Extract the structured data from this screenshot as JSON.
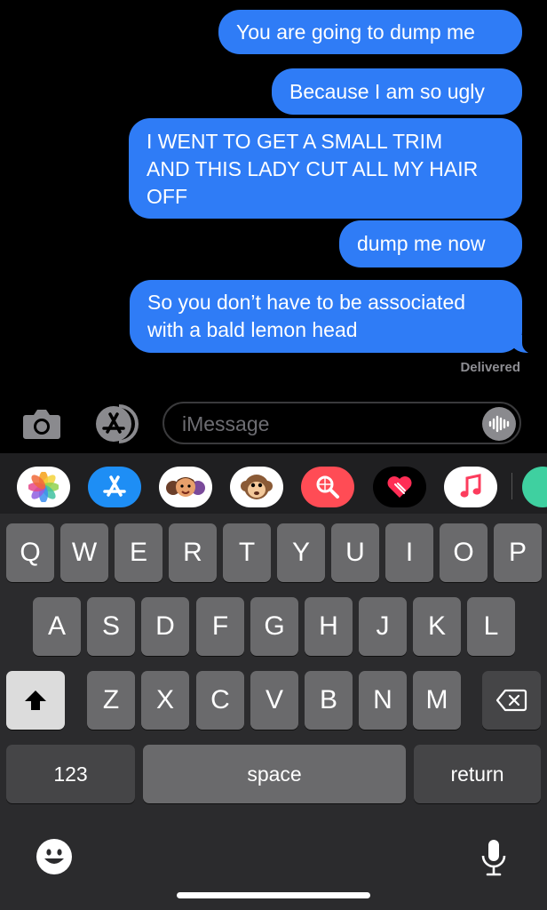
{
  "messages": [
    {
      "text": "You are going to dump me"
    },
    {
      "text": "Because I am so ugly"
    },
    {
      "text": "I WENT TO GET A SMALL TRIM\nAND THIS LADY CUT ALL MY HAIR\nOFF"
    },
    {
      "text": "dump me now"
    },
    {
      "text": "So you don’t have to be associated\nwith a bald lemon head"
    }
  ],
  "status": "Delivered",
  "composer": {
    "placeholder": "iMessage"
  },
  "app_drawer": [
    "photos-icon",
    "app-store-icon",
    "memoji-icon",
    "animoji-monkey-icon",
    "web-search-icon",
    "digital-touch-icon",
    "music-icon"
  ],
  "keyboard": {
    "row1": [
      "Q",
      "W",
      "E",
      "R",
      "T",
      "Y",
      "U",
      "I",
      "O",
      "P"
    ],
    "row2": [
      "A",
      "S",
      "D",
      "F",
      "G",
      "H",
      "J",
      "K",
      "L"
    ],
    "row3": [
      "Z",
      "X",
      "C",
      "V",
      "B",
      "N",
      "M"
    ],
    "numbers_label": "123",
    "space_label": "space",
    "return_label": "return"
  },
  "colors": {
    "bubble": "#2f7cf6",
    "background": "#000000",
    "keyboard": "#2b2b2d",
    "key": "#6a6a6c"
  }
}
